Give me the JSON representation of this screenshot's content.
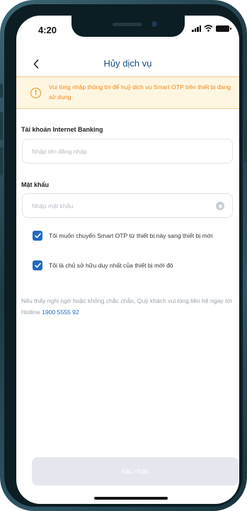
{
  "status_bar": {
    "time": "4:20"
  },
  "header": {
    "title": "Hủy dịch vụ"
  },
  "warning": {
    "text": "Vui lòng nhập thông tin để huỷ dịch vụ Smart OTP trên thiết bị đang sử dụng"
  },
  "form": {
    "username": {
      "label": "Tài khoản Internet Banking",
      "placeholder": "Nhập tên đăng nhập",
      "value": ""
    },
    "password": {
      "label": "Mật khẩu",
      "placeholder": "Nhập mật khẩu",
      "value": ""
    }
  },
  "checks": [
    {
      "label": "Tôi muốn chuyển Smart OTP từ thiết bị này sang thiết bị mới",
      "checked": true
    },
    {
      "label": "Tôi là chủ sở hữu duy nhất của thiết bị mới đó",
      "checked": true
    }
  ],
  "note": {
    "text": "Nếu thấy nghi ngờ hoặc không chắc chắn, Quý khách vui lòng liên hệ ngay tới Hotline",
    "hotline": "1900 5555 92"
  },
  "footer": {
    "confirm_label": "Xác nhận"
  },
  "colors": {
    "primary": "#1f6bbf",
    "title": "#1a4f86",
    "warning": "#ee8718",
    "warning_bg": "#fff6e2",
    "disabled_button": "#e4e8ee"
  },
  "icons": {
    "back": "chevron-left-icon",
    "warning": "warning-circle-icon",
    "eye": "eye-icon",
    "check": "check-icon"
  }
}
